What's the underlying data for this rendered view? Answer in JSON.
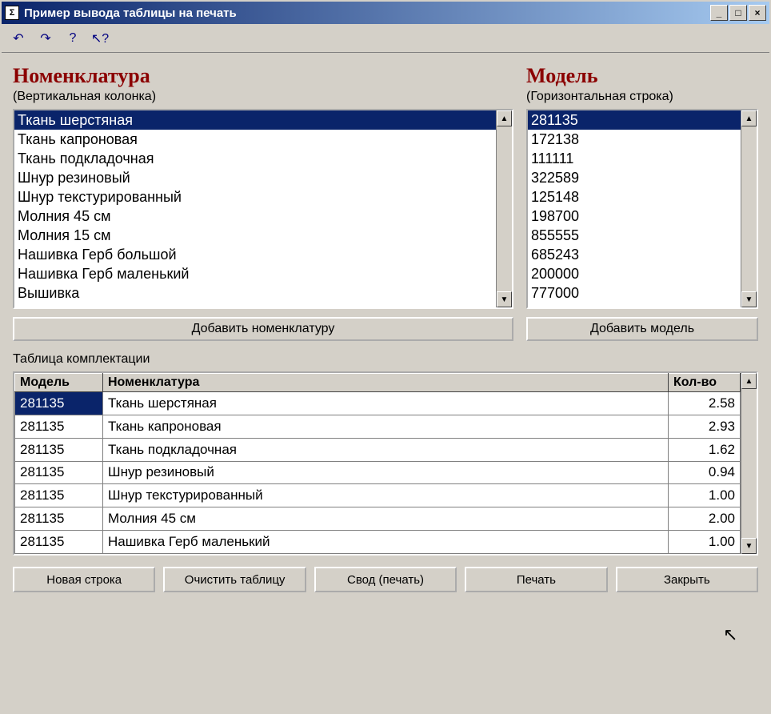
{
  "window": {
    "title": "Пример вывода таблицы на печать",
    "icon_text": "Σ"
  },
  "toolbar": {
    "icons": [
      "undo-icon",
      "redo-icon",
      "help-doc-icon",
      "help-arrow-icon"
    ]
  },
  "nomenclature": {
    "title": "Номенклатура",
    "subtitle": "(Вертикальная колонка)",
    "items": [
      "Ткань шерстяная",
      "Ткань капроновая",
      "Ткань подкладочная",
      "Шнур резиновый",
      "Шнур текстурированный",
      "Молния 45 см",
      "Молния 15 см",
      "Нашивка Герб большой",
      "Нашивка Герб маленький",
      "Вышивка"
    ],
    "selected_index": 0,
    "add_button": "Добавить номенклатуру"
  },
  "model": {
    "title": "Модель",
    "subtitle": "(Горизонтальная строка)",
    "items": [
      "281135",
      "172138",
      "111111",
      "322589",
      "125148",
      "198700",
      "855555",
      "685243",
      "200000",
      "777000"
    ],
    "selected_index": 0,
    "add_button": "Добавить модель"
  },
  "table": {
    "label": "Таблица комплектации",
    "headers": {
      "model": "Модель",
      "nomenclature": "Номенклатура",
      "qty": "Кол-во"
    },
    "rows": [
      {
        "model": "281135",
        "nomenclature": "Ткань шерстяная",
        "qty": "2.58"
      },
      {
        "model": "281135",
        "nomenclature": "Ткань капроновая",
        "qty": "2.93"
      },
      {
        "model": "281135",
        "nomenclature": "Ткань подкладочная",
        "qty": "1.62"
      },
      {
        "model": "281135",
        "nomenclature": "Шнур резиновый",
        "qty": "0.94"
      },
      {
        "model": "281135",
        "nomenclature": "Шнур текстурированный",
        "qty": "1.00"
      },
      {
        "model": "281135",
        "nomenclature": "Молния 45 см",
        "qty": "2.00"
      },
      {
        "model": "281135",
        "nomenclature": "Нашивка Герб маленький",
        "qty": "1.00"
      }
    ],
    "selected_row": 0
  },
  "buttons": {
    "new_row": "Новая строка",
    "clear": "Очистить таблицу",
    "summary": "Свод (печать)",
    "print": "Печать",
    "close": "Закрыть"
  }
}
